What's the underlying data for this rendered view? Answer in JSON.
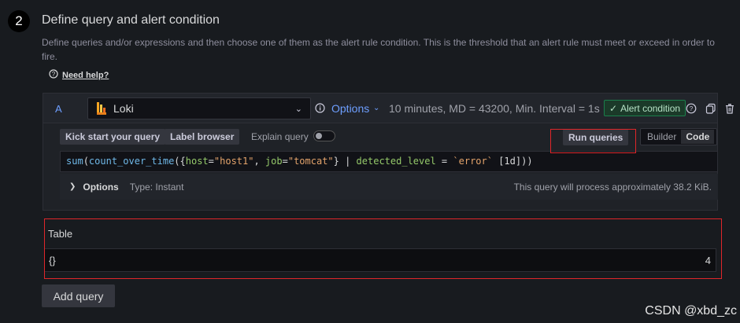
{
  "section": {
    "step_number": "2",
    "title": "Define query and alert condition",
    "description": "Define queries and/or expressions and then choose one of them as the alert rule condition. This is the threshold that an alert rule must meet or exceed in order to fire.",
    "help_label": "Need help?"
  },
  "query": {
    "ref_id": "A",
    "datasource": "Loki",
    "options_label": "Options",
    "meta": "10 minutes, MD = 43200, Min. Interval = 1s",
    "alert_condition_label": "Alert condition",
    "kick_start_label": "Kick start your query",
    "label_browser_label": "Label browser",
    "explain_label": "Explain query",
    "explain_enabled": false,
    "run_label": "Run queries",
    "modes": [
      "Builder",
      "Code"
    ],
    "active_mode": "Code",
    "code_tokens": [
      {
        "t": "sum",
        "c": "fn"
      },
      {
        "t": "(",
        "c": "p"
      },
      {
        "t": "count_over_time",
        "c": "fn"
      },
      {
        "t": "({",
        "c": "p"
      },
      {
        "t": "host",
        "c": "lbl"
      },
      {
        "t": "=",
        "c": "p"
      },
      {
        "t": "\"host1\"",
        "c": "str"
      },
      {
        "t": ", ",
        "c": "p"
      },
      {
        "t": "job",
        "c": "lbl"
      },
      {
        "t": "=",
        "c": "p"
      },
      {
        "t": "\"tomcat\"",
        "c": "str"
      },
      {
        "t": "} | ",
        "c": "p"
      },
      {
        "t": "detected_level",
        "c": "lbl"
      },
      {
        "t": " = ",
        "c": "p"
      },
      {
        "t": "`error`",
        "c": "str"
      },
      {
        "t": " [1d]))",
        "c": "p"
      }
    ],
    "options_row": {
      "label": "Options",
      "type": "Type: Instant",
      "info": "This query will process approximately 38.2 KiB."
    }
  },
  "table": {
    "title": "Table",
    "row_label": "{}",
    "row_value": "4"
  },
  "add_query_label": "Add query",
  "watermark": "CSDN @xbd_zc"
}
